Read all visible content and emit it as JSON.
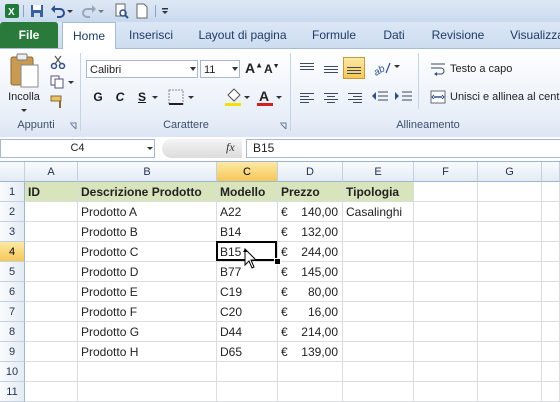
{
  "qat": {
    "icons": [
      "excel-icon",
      "save-icon",
      "undo-icon",
      "redo-icon",
      "print-preview-icon",
      "new-document-icon",
      "customize-icon"
    ]
  },
  "tabs": [
    {
      "label": "File"
    },
    {
      "label": "Home"
    },
    {
      "label": "Inserisci"
    },
    {
      "label": "Layout di pagina"
    },
    {
      "label": "Formule"
    },
    {
      "label": "Dati"
    },
    {
      "label": "Revisione"
    },
    {
      "label": "Visualizza"
    }
  ],
  "ribbon": {
    "clipboard": {
      "paste_label": "Incolla",
      "group_label": "Appunti"
    },
    "font": {
      "font_name": "Calibri",
      "font_size": "11",
      "bold": "G",
      "italic": "C",
      "underline": "S",
      "group_label": "Carattere"
    },
    "alignment": {
      "wrap_text": "Testo a capo",
      "merge_center": "Unisci e allinea al centro",
      "group_label": "Allineamento"
    }
  },
  "formula_bar": {
    "name_box": "C4",
    "fx": "fx",
    "content": "B15"
  },
  "columns": [
    "A",
    "B",
    "C",
    "D",
    "E",
    "F",
    "G"
  ],
  "rows": [
    "1",
    "2",
    "3",
    "4",
    "5",
    "6",
    "7",
    "8",
    "9",
    "10",
    "11"
  ],
  "table": {
    "headers": [
      "ID",
      "Descrizione Prodotto",
      "Modello",
      "Prezzo",
      "Tipologia"
    ],
    "rows": [
      {
        "desc": "Prodotto A",
        "model": "A22",
        "currency": "€",
        "price": "140,00",
        "type": "Casalinghi"
      },
      {
        "desc": "Prodotto B",
        "model": "B14",
        "currency": "€",
        "price": "132,00",
        "type": ""
      },
      {
        "desc": "Prodotto C",
        "model": "B15",
        "currency": "€",
        "price": "244,00",
        "type": ""
      },
      {
        "desc": "Prodotto D",
        "model": "B77",
        "currency": "€",
        "price": "145,00",
        "type": ""
      },
      {
        "desc": "Prodotto E",
        "model": "C19",
        "currency": "€",
        "price": "80,00",
        "type": ""
      },
      {
        "desc": "Prodotto F",
        "model": "C20",
        "currency": "€",
        "price": "16,00",
        "type": ""
      },
      {
        "desc": "Prodotto G",
        "model": "D44",
        "currency": "€",
        "price": "214,00",
        "type": ""
      },
      {
        "desc": "Prodotto H",
        "model": "D65",
        "currency": "€",
        "price": "139,00",
        "type": ""
      }
    ]
  },
  "colors": {
    "file_tab": "#2a7a3b",
    "header_fill": "#d7e4bc",
    "selection_header": "#f6c758"
  }
}
